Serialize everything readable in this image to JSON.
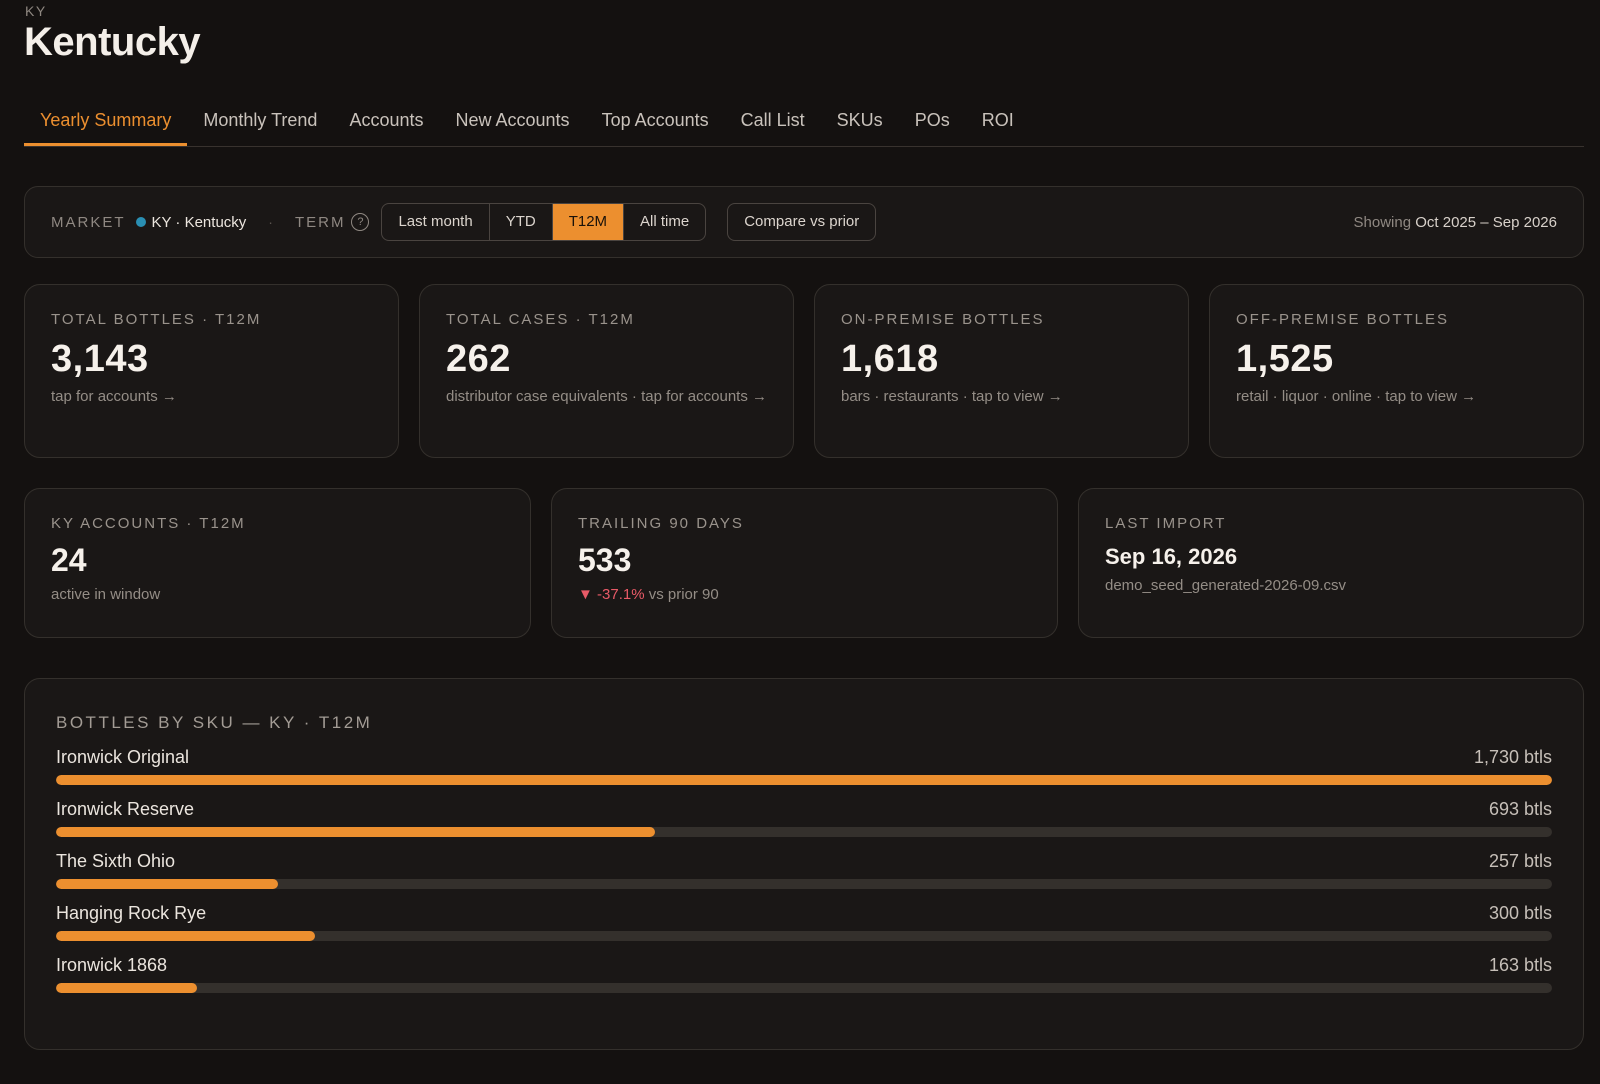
{
  "header": {
    "eyebrow": "KY",
    "title": "Kentucky"
  },
  "tabs": [
    {
      "label": "Yearly Summary",
      "active": true
    },
    {
      "label": "Monthly Trend"
    },
    {
      "label": "Accounts"
    },
    {
      "label": "New Accounts"
    },
    {
      "label": "Top Accounts"
    },
    {
      "label": "Call List"
    },
    {
      "label": "SKUs"
    },
    {
      "label": "POs"
    },
    {
      "label": "ROI"
    }
  ],
  "filters": {
    "market_label": "MARKET",
    "market_value": "KY · Kentucky",
    "market_dot_color": "#2a8fb3",
    "separator": "·",
    "term_label": "TERM",
    "help_icon": "?",
    "terms": [
      "Last month",
      "YTD",
      "T12M",
      "All time"
    ],
    "active_term": "T12M",
    "compare_label": "Compare vs prior",
    "showing_prefix": "Showing",
    "showing_range": "Oct 2025 – Sep 2026"
  },
  "kpis": [
    {
      "label": "TOTAL BOTTLES · T12M",
      "value": "3,143",
      "sub": "tap for accounts →"
    },
    {
      "label": "TOTAL CASES · T12M",
      "value": "262",
      "sub": "distributor case equivalents · tap for accounts →"
    },
    {
      "label": "ON-PREMISE BOTTLES",
      "value": "1,618",
      "sub": "bars · restaurants · tap to view →"
    },
    {
      "label": "OFF-PREMISE BOTTLES",
      "value": "1,525",
      "sub": "retail · liquor · online · tap to view →"
    }
  ],
  "stats": {
    "accounts": {
      "label": "KY ACCOUNTS · T12M",
      "value": "24",
      "sub": "active in window"
    },
    "trailing": {
      "label": "TRAILING 90 DAYS",
      "value": "533",
      "delta": "▼ -37.1%",
      "delta_suffix": "vs prior 90",
      "delta_color": "#e85a67"
    },
    "import": {
      "label": "LAST IMPORT",
      "date": "Sep 16, 2026",
      "file": "demo_seed_generated-2026-09.csv"
    }
  },
  "chart_data": {
    "type": "bar",
    "title": "BOTTLES BY SKU — KY · T12M",
    "categories": [
      "Ironwick Original",
      "Ironwick Reserve",
      "The Sixth Ohio",
      "Hanging Rock Rye",
      "Ironwick 1868"
    ],
    "values": [
      1730,
      693,
      257,
      300,
      163
    ],
    "value_labels": [
      "1,730 btls",
      "693 btls",
      "257 btls",
      "300 btls",
      "163 btls"
    ],
    "max": 1730,
    "bar_color": "#ec8f2f"
  }
}
